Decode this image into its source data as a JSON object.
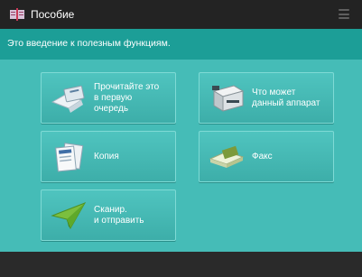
{
  "header": {
    "title": "Пособие",
    "app_icon": "book-icon",
    "menu_icon": "menu-icon"
  },
  "intro": {
    "text": "Это введение к полезным функциям."
  },
  "buttons": [
    {
      "label": "Прочитайте это\nв первую\nочередь",
      "icon": "read-first-icon"
    },
    {
      "label": "Что может\nданный аппарат",
      "icon": "printer-device-icon"
    },
    {
      "label": "Копия",
      "icon": "copy-documents-icon"
    },
    {
      "label": "Факс",
      "icon": "fax-icon"
    },
    {
      "label": "Сканир.\nи отправить",
      "icon": "scan-send-icon"
    }
  ],
  "colors": {
    "header_bg": "#232323",
    "intro_bg": "#1c9e97",
    "content_bg": "#45bcb7",
    "button_bg": "#48bab5",
    "bottom_bg": "#2a2a2a"
  }
}
